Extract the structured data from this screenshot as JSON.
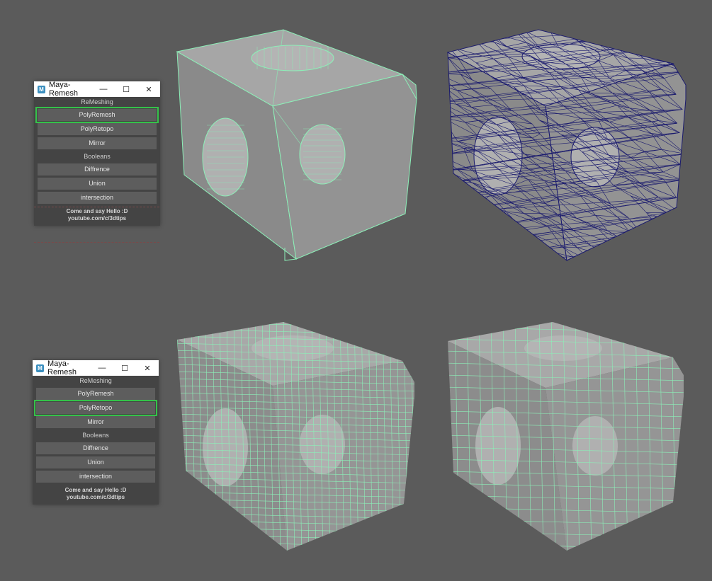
{
  "panels": [
    {
      "title": "Maya-Remesh",
      "section1": "ReMeshing",
      "buttons1": [
        "PolyRemesh",
        "PolyRetopo",
        "Mirror"
      ],
      "section2": "Booleans",
      "buttons2": [
        "Diffrence",
        "Union",
        "intersection"
      ],
      "footer1": "Come and say Hello :D",
      "footer2": "youtube.com/c/3dtips",
      "selected": "PolyRemesh"
    },
    {
      "title": "Maya-Remesh",
      "section1": "ReMeshing",
      "buttons1": [
        "PolyRemesh",
        "PolyRetopo",
        "Mirror"
      ],
      "section2": "Booleans",
      "buttons2": [
        "Diffrence",
        "Union",
        "intersection"
      ],
      "footer1": "Come and say Hello :D",
      "footer2": "youtube.com/c/3dtips",
      "selected": "PolyRetopo"
    }
  ],
  "icons": {
    "logo": "maya-logo-icon",
    "minimize": "minimize-icon",
    "maximize": "maximize-icon",
    "close": "close-icon"
  },
  "glyphs": {
    "logo": "M",
    "minimize": "—",
    "maximize": "☐",
    "close": "✕"
  },
  "colors": {
    "background": "#5b5b5b",
    "panel": "#444444",
    "button": "#5d5d5d",
    "highlight": "#35c24a",
    "wire_green": "#8cf0b8",
    "wire_blue": "#1a1a6e",
    "mesh_face": "#9a9a9a"
  },
  "viewports": [
    {
      "name": "viewport-original-mesh",
      "wire": "green",
      "density": "low"
    },
    {
      "name": "viewport-triangulated-mesh",
      "wire": "blue",
      "density": "triangles"
    },
    {
      "name": "viewport-remeshed-quads",
      "wire": "green",
      "density": "high"
    },
    {
      "name": "viewport-retopo-quads",
      "wire": "green",
      "density": "medium"
    }
  ]
}
